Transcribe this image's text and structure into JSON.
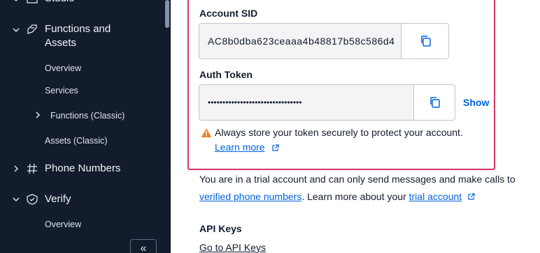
{
  "sidebar": {
    "studio": {
      "label": "Studio"
    },
    "functions": {
      "label_line1": "Functions and",
      "label_line2": "Assets"
    },
    "sub_items": [
      "Overview",
      "Services",
      "Functions (Classic)",
      "Assets (Classic)"
    ],
    "phone_numbers": {
      "label": "Phone Numbers"
    },
    "verify": {
      "label": "Verify",
      "sub_overview": "Overview"
    },
    "collapse_label": "«"
  },
  "main": {
    "account_sid": {
      "label": "Account SID",
      "value": "AC8b0dba623ceaaa4b48817b58c586d4"
    },
    "auth_token": {
      "label": "Auth Token",
      "value": "••••••••••••••••••••••••••••••••",
      "show_label": "Show"
    },
    "warning": {
      "text": "Always store your token securely to protect your account.",
      "learn_more": "Learn more"
    },
    "trial": {
      "line1": "You are in a trial account and can only send messages and make calls to",
      "verified_link": "verified phone numbers",
      "middle": ". Learn more about your ",
      "trial_link": "trial account"
    },
    "api_keys": {
      "title": "API Keys",
      "link": "Go to API Keys"
    }
  },
  "colors": {
    "sidebar_bg": "#121c2d",
    "accent_link": "#0263e0",
    "highlight": "#d6336c",
    "warning": "#f47c22"
  }
}
